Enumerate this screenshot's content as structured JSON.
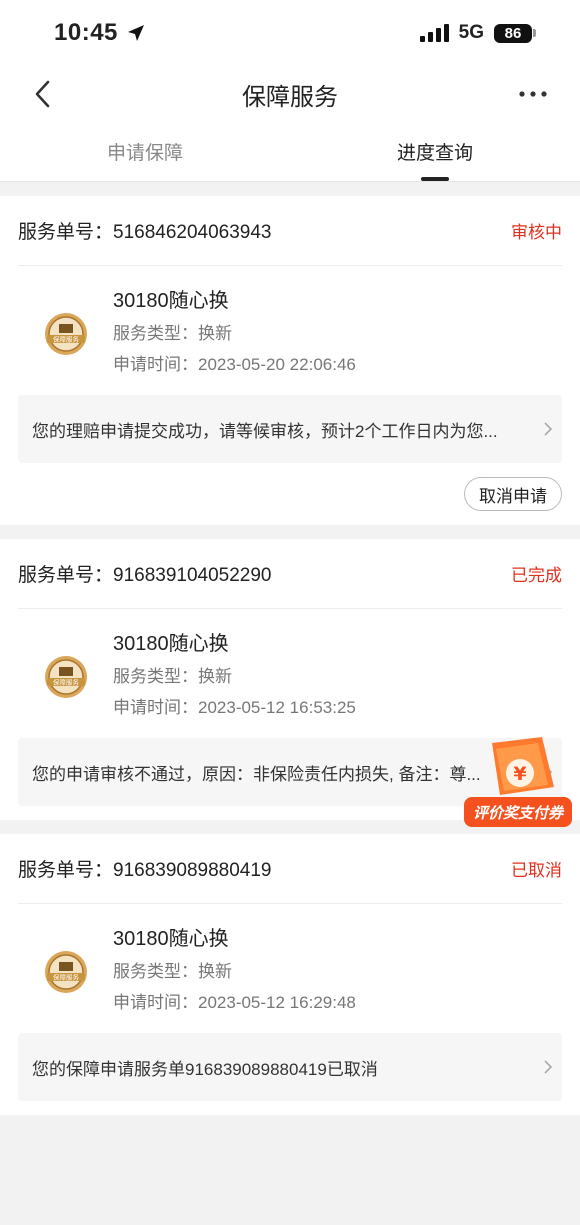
{
  "status_bar": {
    "time": "10:45",
    "network": "5G",
    "battery": "86"
  },
  "header": {
    "title": "保障服务"
  },
  "tabs": [
    {
      "label": "申请保障"
    },
    {
      "label": "进度查询"
    }
  ],
  "orders": [
    {
      "order_no": "服务单号：516846204063943",
      "status": "审核中",
      "product": "30180随心换",
      "service_type": "服务类型：换新",
      "apply_time": "申请时间：2023-05-20 22:06:46",
      "note": "您的理赔申请提交成功，请等候审核，预计2个工作日内为您...",
      "action": "取消申请"
    },
    {
      "order_no": "服务单号：916839104052290",
      "status": "已完成",
      "product": "30180随心换",
      "service_type": "服务类型：换新",
      "apply_time": "申请时间：2023-05-12 16:53:25",
      "note": "您的申请审核不通过，原因：非保险责任内损失, 备注：尊..."
    },
    {
      "order_no": "服务单号：916839089880419",
      "status": "已取消",
      "product": "30180随心换",
      "service_type": "服务类型：换新",
      "apply_time": "申请时间：2023-05-12 16:29:48",
      "note": "您的保障申请服务单916839089880419已取消"
    }
  ],
  "seal_label": "保障服务",
  "promo": {
    "label": "评价奖支付券",
    "symbol": "¥"
  },
  "colors": {
    "status_red": "#e0301e",
    "seal_gold": "#c8953f",
    "promo_orange": "#f5511e"
  }
}
